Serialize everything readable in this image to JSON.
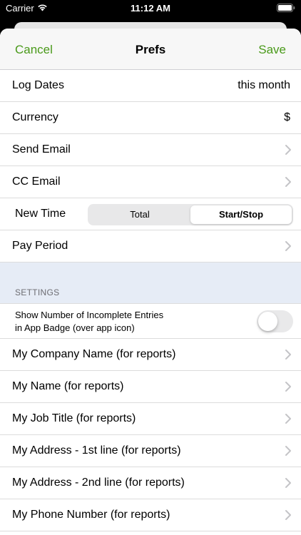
{
  "status_bar": {
    "carrier": "Carrier",
    "time": "11:12 AM"
  },
  "nav": {
    "cancel": "Cancel",
    "title": "Prefs",
    "save": "Save",
    "accent_color": "#4a9a1a"
  },
  "rows_top": [
    {
      "label": "Log Dates",
      "value": "this month"
    },
    {
      "label": "Currency",
      "value": "$"
    },
    {
      "label": "Send Email"
    },
    {
      "label": "CC Email"
    }
  ],
  "new_time": {
    "label": "New Time",
    "options": [
      "Total",
      "Start/Stop"
    ],
    "selected": "Start/Stop"
  },
  "pay_period": {
    "label": "Pay Period"
  },
  "settings": {
    "header": "SETTINGS",
    "badge_toggle": {
      "label_line1": "Show Number of Incomplete Entries",
      "label_line2": "in App Badge (over app icon)",
      "on": false
    },
    "items": [
      {
        "label": "My Company Name (for reports)"
      },
      {
        "label": "My Name (for reports)"
      },
      {
        "label": "My Job Title (for reports)"
      },
      {
        "label": "My Address - 1st line (for reports)"
      },
      {
        "label": "My Address - 2nd line (for reports)"
      },
      {
        "label": "My Phone Number (for reports)"
      }
    ]
  },
  "icons": {
    "wifi": "wifi-icon",
    "battery": "battery-icon",
    "chevron": "chevron-right-icon"
  }
}
